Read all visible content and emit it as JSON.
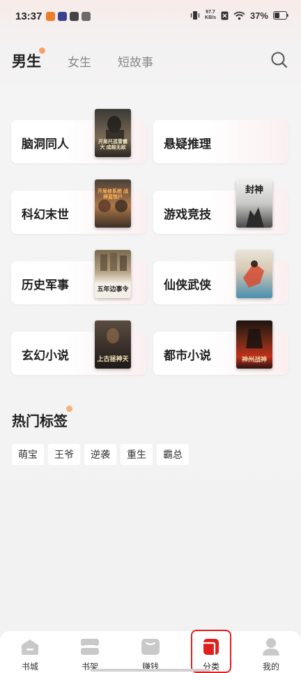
{
  "status_bar": {
    "time": "13:37",
    "net_speed_value": "97.7",
    "net_speed_unit": "KB/s",
    "battery": "37%",
    "app_icon_colors": [
      "#f07b2a",
      "#3b3f8f",
      "#444444",
      "#6b6b6b"
    ]
  },
  "top_tabs": [
    {
      "label": "男生",
      "active": true
    },
    {
      "label": "女生",
      "active": false
    },
    {
      "label": "短故事",
      "active": false
    }
  ],
  "categories": [
    {
      "label": "脑洞同人",
      "cover_title": "开局托孤雷霸大 成超无敌",
      "cover_colors": [
        "#3a3a34",
        "#7a6a55"
      ],
      "title_color": "#f2e6c0"
    },
    {
      "label": "悬疑推理",
      "cover_title": "",
      "cover_colors": [],
      "title_color": ""
    },
    {
      "label": "科幻末世",
      "cover_title": "开局修系统 战神蓝惊户",
      "cover_colors": [
        "#4a4038",
        "#b07848"
      ],
      "title_color": "#ffb35a"
    },
    {
      "label": "游戏竞技",
      "cover_title": "封神",
      "cover_colors": [
        "#e8e8e6",
        "#5b5b5b"
      ],
      "title_color": "#1a1a1a"
    },
    {
      "label": "历史军事",
      "cover_title": "五年边事令",
      "cover_colors": [
        "#7a6a50",
        "#f4efe6"
      ],
      "title_color": "#222222"
    },
    {
      "label": "仙侠武侠",
      "cover_title": "",
      "cover_colors": [
        "#e9e4d8",
        "#d64b2f"
      ],
      "title_color": "#d23a2a"
    },
    {
      "label": "玄幻小说",
      "cover_title": "上古拯神天",
      "cover_colors": [
        "#5a4c40",
        "#1e1a18"
      ],
      "title_color": "#f4e3b8"
    },
    {
      "label": "都市小说",
      "cover_title": "神州战神",
      "cover_colors": [
        "#1d1410",
        "#c0301c"
      ],
      "title_color": "#f2d9a8"
    }
  ],
  "hot_tags": {
    "title": "热门标签",
    "tags": [
      "萌宝",
      "王爷",
      "逆袭",
      "重生",
      "霸总"
    ]
  },
  "bottom_nav": [
    {
      "label": "书城",
      "icon": "bookstore-icon",
      "active": false
    },
    {
      "label": "书架",
      "icon": "bookshelf-icon",
      "active": false
    },
    {
      "label": "赚钱",
      "icon": "earn-money-icon",
      "active": false
    },
    {
      "label": "分类",
      "icon": "category-icon",
      "active": true
    },
    {
      "label": "我的",
      "icon": "profile-icon",
      "active": false
    }
  ],
  "colors": {
    "accent": "#e0201d",
    "tab_dot": "#f5a36a"
  }
}
